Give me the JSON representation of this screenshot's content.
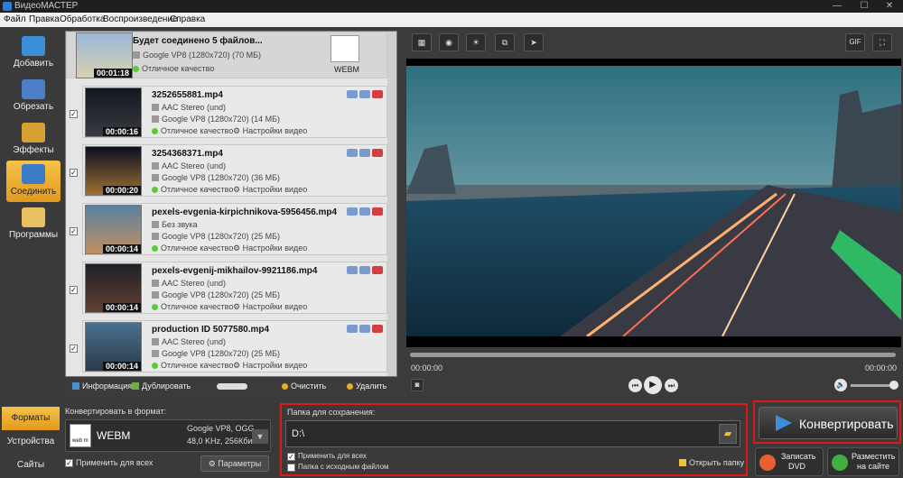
{
  "app": {
    "title": "ВидеоМАСТЕР"
  },
  "menu": [
    "Файл",
    "Правка",
    "Обработка",
    "Воспроизведение",
    "Справка"
  ],
  "sidebar": [
    "Добавить",
    "Обрезать",
    "Эффекты",
    "Соединить",
    "Программы"
  ],
  "merged": {
    "title": "Будет соединено 5 файлов...",
    "codec": "Google VP8 (1280x720) (70 МБ)",
    "quality": "Отличное качество",
    "duration": "00:01:18",
    "badge": "WEBM"
  },
  "files": [
    {
      "name": "3252655881.mp4",
      "audio": "AAC Stereo (und)",
      "video": "Google VP8 (1280x720) (14 МБ)",
      "quality": "Отличное качество",
      "settings": "Настройки видео",
      "duration": "00:00:16"
    },
    {
      "name": "3254368371.mp4",
      "audio": "AAC Stereo (und)",
      "video": "Google VP8 (1280x720) (36 МБ)",
      "quality": "Отличное качество",
      "settings": "Настройки видео",
      "duration": "00:00:20"
    },
    {
      "name": "pexels-evgenia-kirpichnikova-5956456.mp4",
      "audio": "Без звука",
      "video": "Google VP8 (1280x720) (25 МБ)",
      "quality": "Отличное качество",
      "settings": "Настройки видео",
      "duration": "00:00:14"
    },
    {
      "name": "pexels-evgenij-mikhailov-9921186.mp4",
      "audio": "AAC Stereo (und)",
      "video": "Google VP8 (1280x720) (25 МБ)",
      "quality": "Отличное качество",
      "settings": "Настройки видео",
      "duration": "00:00:14"
    },
    {
      "name": "production ID 5077580.mp4",
      "audio": "AAC Stereo (und)",
      "video": "Google VP8 (1280x720) (25 МБ)",
      "quality": "Отличное качество",
      "settings": "Настройки видео",
      "duration": "00:00:14"
    }
  ],
  "list_tools": {
    "info": "Информация",
    "duplicate": "Дублировать",
    "clear": "Очистить",
    "delete": "Удалить"
  },
  "preview": {
    "toolbar": [
      "film-icon",
      "eye-icon",
      "brightness-icon",
      "crop-icon",
      "speed-icon"
    ],
    "gif": "GIF",
    "time_start": "00:00:00",
    "time_end": "00:00:00",
    "progress": 0
  },
  "bottom": {
    "tabs": [
      "Форматы",
      "Устройства",
      "Сайты"
    ],
    "convert_to": "Конвертировать в формат:",
    "format": "WEBM",
    "format_badge": "web m",
    "codec_line1": "Google VP8, OGG",
    "codec_line2": "48,0 KHz, 256Кбит",
    "apply_all": "Применить для всех",
    "params": "Параметры",
    "save_folder_label": "Папка для сохранения:",
    "save_path": "D:\\",
    "apply_all2": "Применить для всех",
    "source_folder": "Папка с исходным файлом",
    "open_folder": "Открыть папку",
    "convert": "Конвертировать",
    "burn_dvd_1": "Записать",
    "burn_dvd_2": "DVD",
    "publish_1": "Разместить",
    "publish_2": "на сайте"
  },
  "colors": {
    "accent": "#f0b030",
    "highlight": "#e01818",
    "quality_dot": "#5dc73a"
  }
}
